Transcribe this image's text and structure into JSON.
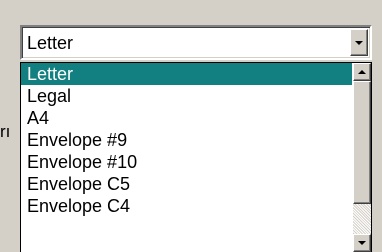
{
  "background_text": "rı",
  "combo": {
    "value": "Letter",
    "dropdown_icon": "chevron-down-icon"
  },
  "list": {
    "items": [
      {
        "label": "Letter",
        "selected": true
      },
      {
        "label": "Legal",
        "selected": false
      },
      {
        "label": "A4",
        "selected": false
      },
      {
        "label": "Envelope #9",
        "selected": false
      },
      {
        "label": "Envelope #10",
        "selected": false
      },
      {
        "label": "Envelope C5",
        "selected": false
      },
      {
        "label": "Envelope C4",
        "selected": false
      }
    ],
    "scroll_up_icon": "chevron-up-icon",
    "scroll_down_icon": "chevron-down-icon"
  },
  "colors": {
    "selection": "#128080",
    "face": "#d4d0c8"
  }
}
